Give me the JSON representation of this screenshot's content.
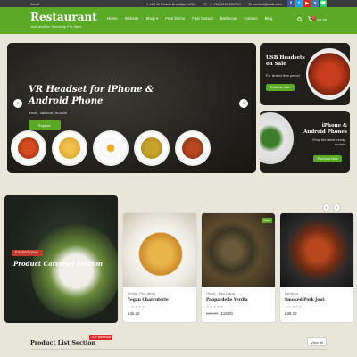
{
  "topbar": {
    "about": "About",
    "address": "100 W Peach Brooklyn, USA",
    "phone": "+1 212 0123456789",
    "email": "contact@mail.com"
  },
  "header": {
    "brand": "Restaurant",
    "tagline": "Just another Storeship Pro Sites",
    "nav": [
      "Home",
      "Website",
      "Shop",
      "Free Demo",
      "Fast Casual",
      "Barbecue",
      "Contact",
      "Blog"
    ],
    "shop_caret": "▾",
    "cart_count": "0",
    "cart_total": "£0.00"
  },
  "hero": {
    "title": "VR Headset for iPhone & Android Phone",
    "subtitle": "Yeah, salmon, mortis!",
    "button": "Explore"
  },
  "promo1": {
    "title": "USB Headsets on Sale",
    "text": "For limited time period",
    "button": "Grab the Offer"
  },
  "promo2": {
    "title": "iPhone & Android Phones",
    "text": "Shop the latest trendy models",
    "button": "Purchase Now"
  },
  "featured": {
    "badge": "EXCEPTIONAL",
    "title": "Product Carousel Section"
  },
  "products": [
    {
      "category": "Drinks · Fine-dining",
      "name": "Vegan Charcuterie",
      "stars": "★★★★★",
      "old_price": "",
      "price": "£45.20",
      "sale": ""
    },
    {
      "category": "Dinner · Fast casual",
      "name": "Pappardelle Verdia",
      "stars": "★★★★★",
      "old_price": "£28.00",
      "price": "£18.00",
      "sale": "Sale!"
    },
    {
      "category": "Barbecue",
      "name": "Smoked Pork Jowl",
      "stars": "★★★★★",
      "old_price": "",
      "price": "£38.20",
      "sale": ""
    }
  ],
  "product_list": {
    "title": "Product List Section",
    "badge": "TOP Barbecue",
    "view_all": "View all"
  },
  "colors": {
    "brand_green": "#5aaa25",
    "page_bg": "#e8e6d9",
    "badge_red": "#c53a2b"
  },
  "icons": [
    "facebook-icon",
    "twitter-icon",
    "youtube-icon",
    "vk-icon",
    "whatsapp-icon",
    "search-icon",
    "cart-icon",
    "location-icon",
    "phone-icon",
    "mail-icon",
    "arrow-left-icon",
    "arrow-right-icon"
  ]
}
